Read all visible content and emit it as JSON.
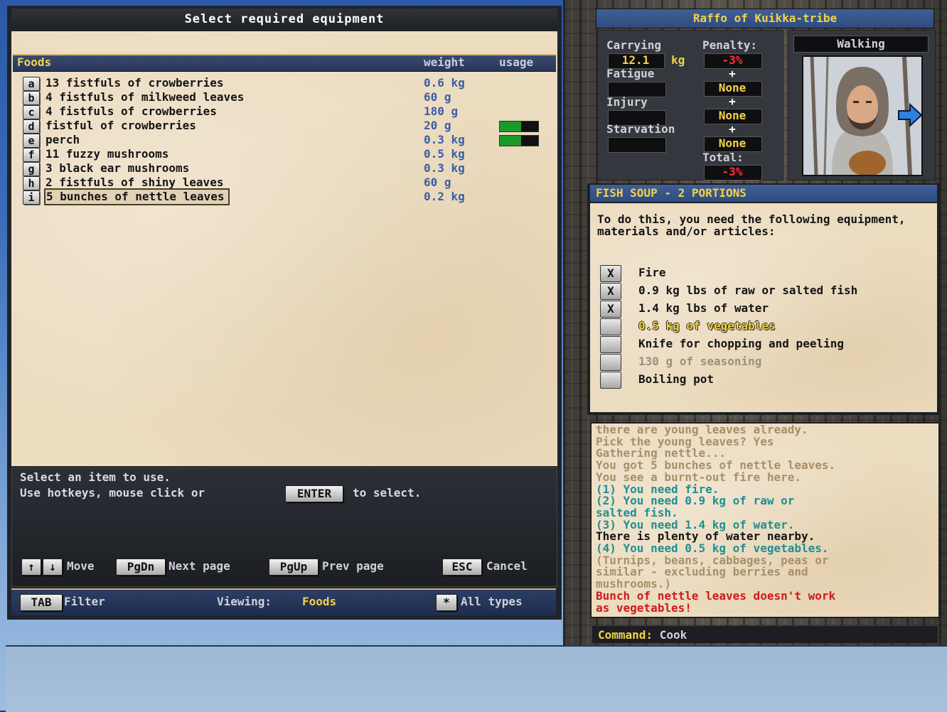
{
  "main": {
    "title": "Select required equipment",
    "category": "Foods",
    "col_weight": "weight",
    "col_usage": "usage",
    "items": [
      {
        "key": "a",
        "name": "13 fistfuls of crowberries",
        "weight": "0.6 kg",
        "usage": null
      },
      {
        "key": "b",
        "name": "4 fistfuls of milkweed leaves",
        "weight": "60 g",
        "usage": null
      },
      {
        "key": "c",
        "name": "4 fistfuls of crowberries",
        "weight": "180 g",
        "usage": null
      },
      {
        "key": "d",
        "name": "fistful of crowberries",
        "weight": "20 g",
        "usage": 0.55
      },
      {
        "key": "e",
        "name": "perch",
        "weight": "0.3 kg",
        "usage": 0.55
      },
      {
        "key": "f",
        "name": "11 fuzzy mushrooms",
        "weight": "0.5 kg",
        "usage": null
      },
      {
        "key": "g",
        "name": "3 black ear mushrooms",
        "weight": "0.3 kg",
        "usage": null
      },
      {
        "key": "h",
        "name": "2 fistfuls of shiny leaves",
        "weight": "60 g",
        "usage": null
      },
      {
        "key": "i",
        "name": "5 bunches of nettle leaves",
        "weight": "0.2 kg",
        "usage": null,
        "selected": true
      }
    ],
    "help_line1": "Select an item to use.",
    "help_line2a": "Use hotkeys, mouse click or",
    "help_enter": "ENTER",
    "help_line2b": "to select.",
    "key_up": "↑",
    "key_down": "↓",
    "label_move": "Move",
    "key_pgdn": "PgDn",
    "label_next": "Next page",
    "key_pgup": "PgUp",
    "label_prev": "Prev page",
    "key_esc": "ESC",
    "label_cancel": "Cancel",
    "key_tab": "TAB",
    "label_filter": "Filter",
    "viewing_label": "Viewing:",
    "viewing_value": "Foods",
    "key_star": "*",
    "label_all_types": "All types"
  },
  "character": {
    "name": "Raffo of Kuikka-tribe",
    "carrying_label": "Carrying",
    "carrying_value": "12.1",
    "carrying_unit": "kg",
    "penalty_label": "Penalty:",
    "penalty_value": "-3%",
    "fatigue_label": "Fatigue",
    "fatigue_penalty": "None",
    "injury_label": "Injury",
    "injury_penalty": "None",
    "starvation_label": "Starvation",
    "starvation_penalty": "None",
    "plus": "+",
    "total_label": "Total:",
    "total_value": "-3%",
    "state": "Walking"
  },
  "recipe": {
    "title": "FISH SOUP - 2 PORTIONS",
    "intro": "To do this, you need the following equipment, materials and/or articles:",
    "requirements": [
      {
        "mark": "X",
        "text": "Fire",
        "status": "met"
      },
      {
        "mark": "X",
        "text": "0.9 kg lbs of raw or salted fish",
        "status": "met"
      },
      {
        "mark": "X",
        "text": "1.4 kg lbs of water",
        "status": "met"
      },
      {
        "mark": "",
        "text": "0.5 kg of vegetables",
        "status": "current"
      },
      {
        "mark": "",
        "text": "Knife for chopping and peeling",
        "status": "missing"
      },
      {
        "mark": "",
        "text": "130 g of seasoning",
        "status": "optional"
      },
      {
        "mark": "",
        "text": "Boiling pot",
        "status": "missing"
      }
    ]
  },
  "log": [
    {
      "text": "there are young leaves already.",
      "style": "old"
    },
    {
      "text": "Pick the young leaves? Yes",
      "style": "old"
    },
    {
      "text": "Gathering nettle...",
      "style": "old"
    },
    {
      "text": "You got 5 bunches of nettle leaves.",
      "style": "old"
    },
    {
      "text": "You see a burnt-out fire here.",
      "style": "old"
    },
    {
      "text": "(1) You need fire.",
      "style": "info"
    },
    {
      "text": "(2) You need 0.9 kg of raw or",
      "style": "info"
    },
    {
      "text": "salted fish.",
      "style": "info"
    },
    {
      "text": "(3) You need 1.4 kg of water.",
      "style": "info"
    },
    {
      "text": "There is plenty of water nearby.",
      "style": "normal"
    },
    {
      "text": "(4) You need 0.5 kg of vegetables.",
      "style": "info"
    },
    {
      "text": "(Turnips, beans, cabbages, peas or",
      "style": "old"
    },
    {
      "text": "similar - excluding berries and",
      "style": "old"
    },
    {
      "text": "mushrooms.)",
      "style": "old"
    },
    {
      "text": "Bunch of nettle leaves doesn't work",
      "style": "error"
    },
    {
      "text": "as vegetables!",
      "style": "error"
    }
  ],
  "command": {
    "label": "Command:",
    "value": "Cook"
  },
  "colors": {
    "accent_yellow": "#f2d24a",
    "weight_blue": "#3b5ea8",
    "error_red": "#cc1a1a",
    "info_teal": "#1f8f93",
    "old_tan": "#a88f6a",
    "usage_green": "#1a9a2a",
    "penalty_red": "#ff3030"
  },
  "icons": {
    "next_arrow": "arrow-right-icon"
  }
}
